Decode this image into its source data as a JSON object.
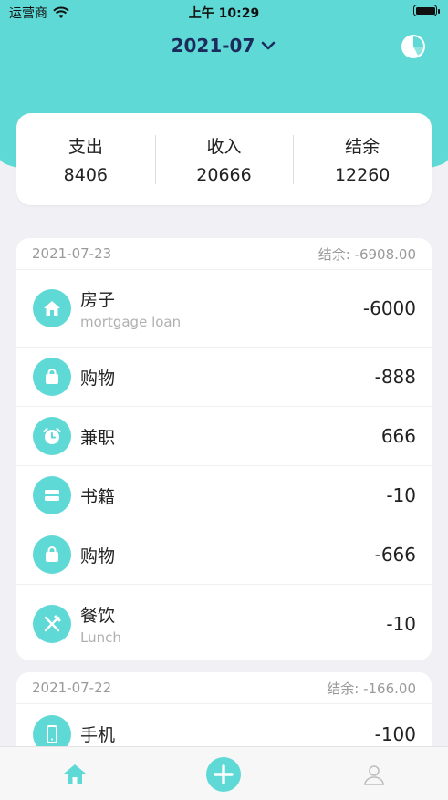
{
  "status_bar": {
    "carrier": "运营商",
    "time": "上午 10:29"
  },
  "header": {
    "month": "2021-07"
  },
  "summary": {
    "expense_label": "支出",
    "expense_value": "8406",
    "income_label": "收入",
    "income_value": "20666",
    "balance_label": "结余",
    "balance_value": "12260"
  },
  "days": [
    {
      "date": "2021-07-23",
      "balance": "结余: -6908.00",
      "records": [
        {
          "icon": "house-icon",
          "category": "房子",
          "note": "mortgage loan",
          "amount": "-6000"
        },
        {
          "icon": "shopping-bag-icon",
          "category": "购物",
          "note": "",
          "amount": "-888"
        },
        {
          "icon": "alarm-clock-icon",
          "category": "兼职",
          "note": "",
          "amount": "666"
        },
        {
          "icon": "book-icon",
          "category": "书籍",
          "note": "",
          "amount": "-10"
        },
        {
          "icon": "shopping-bag-icon",
          "category": "购物",
          "note": "",
          "amount": "-666"
        },
        {
          "icon": "fork-knife-icon",
          "category": "餐饮",
          "note": "Lunch",
          "amount": "-10"
        }
      ]
    },
    {
      "date": "2021-07-22",
      "balance": "结余: -166.00",
      "records": [
        {
          "icon": "phone-icon",
          "category": "手机",
          "note": "",
          "amount": "-100"
        }
      ]
    }
  ],
  "tab_bar": {
    "active_tab": "home"
  },
  "colors": {
    "accent": "#5fd9d5",
    "title": "#1d2b5c",
    "muted": "#9a9a9a"
  }
}
